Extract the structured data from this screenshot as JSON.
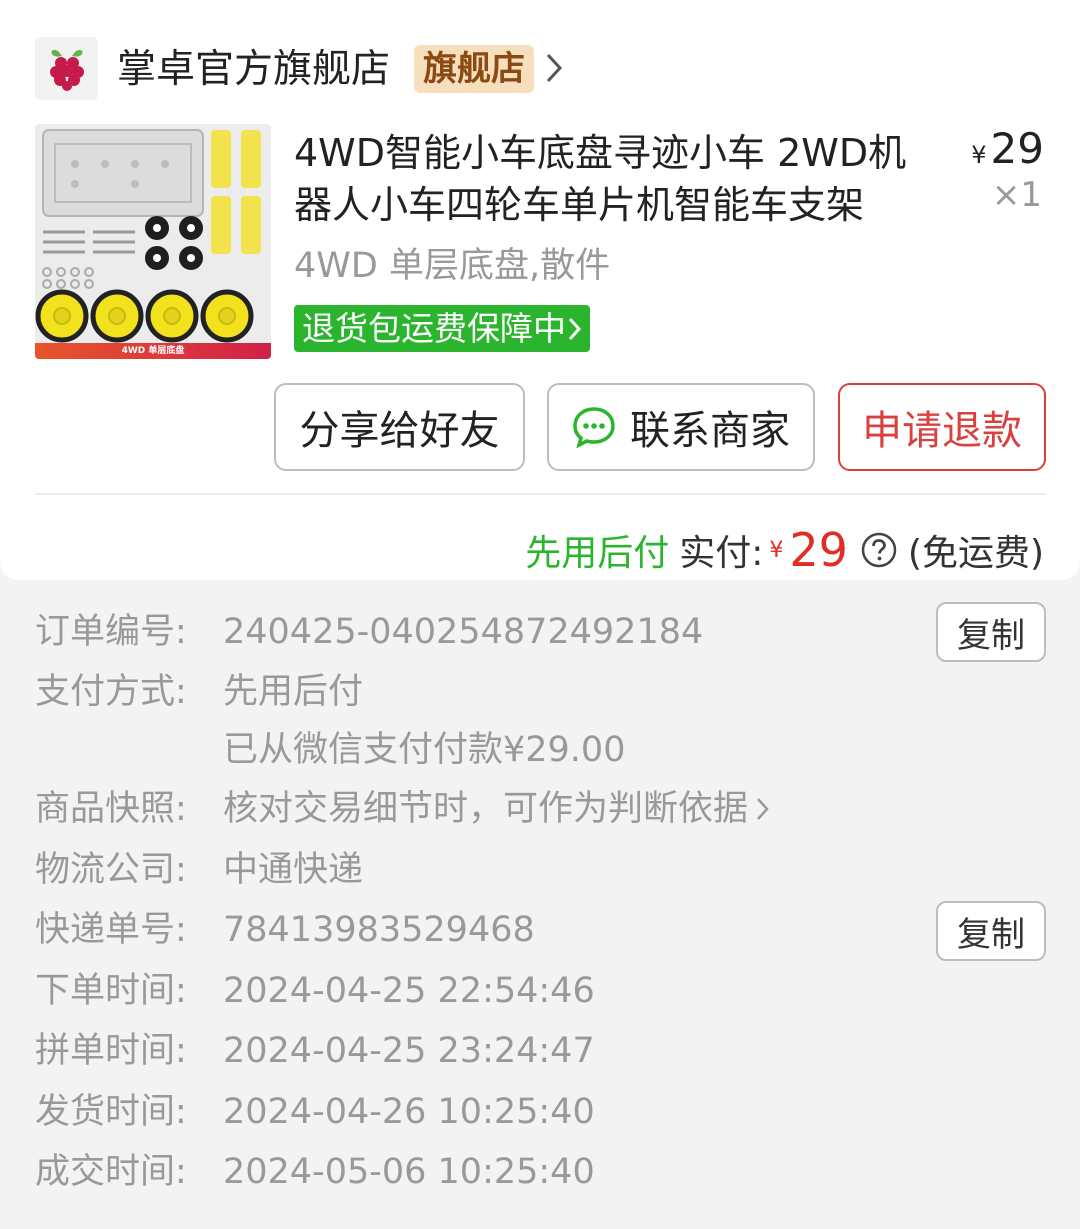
{
  "store": {
    "name": "掌卓官方旗舰店",
    "badge": "旗舰店"
  },
  "product": {
    "title": "4WD智能小车底盘寻迹小车 2WD机器人小车四轮车单片机智能车支架",
    "price_symbol": "¥",
    "price": "29",
    "quantity": "×1",
    "sku": "4WD 单层底盘,散件",
    "guarantee": "退货包运费保障中",
    "image_banner": "4WD 单层底盘"
  },
  "actions": {
    "share": "分享给好友",
    "contact": "联系商家",
    "refund": "申请退款"
  },
  "payment_summary": {
    "method_tag": "先用后付",
    "label": "实付:",
    "currency": "¥",
    "amount": "29",
    "shipping": "(免运费)"
  },
  "order_info": {
    "order_no_label": "订单编号:",
    "order_no": "240425-040254872492184",
    "copy_label": "复制",
    "pay_method_label": "支付方式:",
    "pay_method": "先用后付",
    "pay_detail": "已从微信支付付款¥29.00",
    "snapshot_label": "商品快照:",
    "snapshot": "核对交易细节时，可作为判断依据",
    "courier_label": "物流公司:",
    "courier": "中通快递",
    "tracking_label": "快递单号:",
    "tracking_no": "78413983529468",
    "order_time_label": "下单时间:",
    "order_time": "2024-04-25 22:54:46",
    "group_time_label": "拼单时间:",
    "group_time": "2024-04-25 23:24:47",
    "ship_time_label": "发货时间:",
    "ship_time": "2024-04-26 10:25:40",
    "deal_time_label": "成交时间:",
    "deal_time": "2024-05-06 10:25:40"
  },
  "colors": {
    "accent_red": "#e02e24",
    "green": "#2bb52e",
    "badge_bg": "#f5dfbd"
  }
}
